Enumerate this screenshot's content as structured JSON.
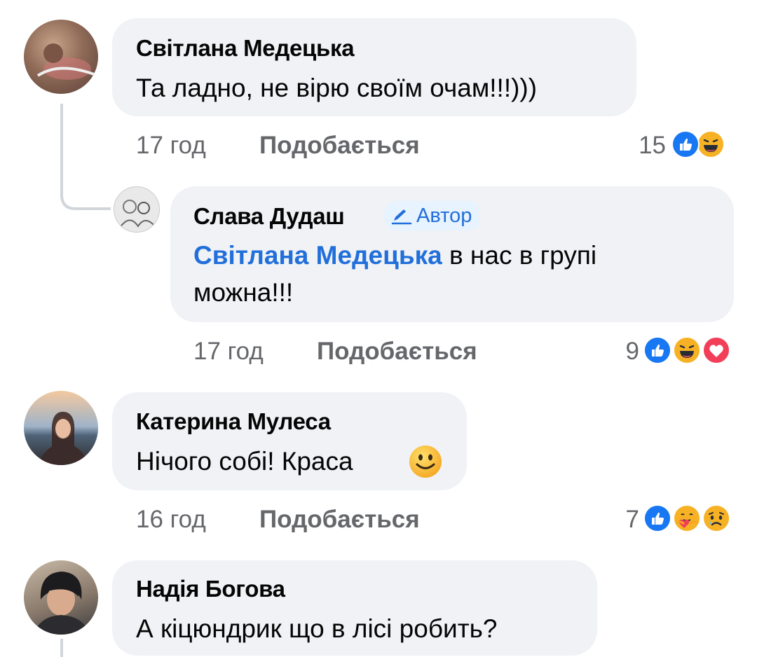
{
  "comments": [
    {
      "author": "Світлана Медецька",
      "text": "Та ладно, не вірю своїм очам!!!)))",
      "time": "17 год",
      "like_label": "Подобається",
      "reaction_count": "15",
      "reactions": [
        "like-icon",
        "haha-icon"
      ],
      "reply": {
        "author": "Слава Дудаш",
        "badge": "Автор",
        "mention": "Світлана Медецька",
        "text_line1": " в нас в групі",
        "text_line2": "можна!!!",
        "time": "17 год",
        "like_label": "Подобається",
        "reaction_count": "9",
        "reactions": [
          "like-icon",
          "haha-icon",
          "love-icon"
        ]
      }
    },
    {
      "author": "Катерина Мулеса",
      "text": "Нічого собі! Краса",
      "emoji": "smile-emoji-icon",
      "time": "16 год",
      "like_label": "Подобається",
      "reaction_count": "7",
      "reactions": [
        "like-icon",
        "care-icon",
        "sad-icon"
      ]
    },
    {
      "author": "Надія Богова",
      "text": "А кіцюндрик що в лісі робить?"
    }
  ],
  "colors": {
    "bubble": "#f0f2f5",
    "meta": "#65676b",
    "accent": "#216fdb",
    "like_blue": "#1877f2",
    "love_red": "#f33e58",
    "haha_yellow": "#f7b125"
  }
}
